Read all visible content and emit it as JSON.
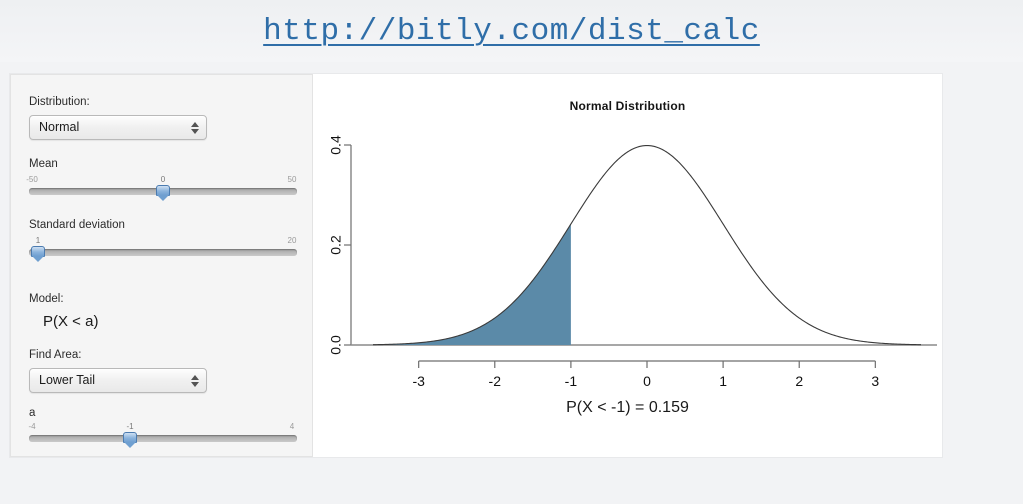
{
  "header": {
    "url": "http://bitly.com/dist_calc",
    "link_color": "#2f6ea8"
  },
  "sidebar": {
    "distribution_label": "Distribution:",
    "distribution_value": "Normal",
    "mean_label": "Mean",
    "mean_slider": {
      "min_label": "-50",
      "value_label": "0",
      "max_label": "50",
      "min": -50,
      "max": 50,
      "value": 0
    },
    "sd_label": "Standard deviation",
    "sd_slider": {
      "min_label": "1",
      "value_label": "1",
      "max_label": "20",
      "min": 1,
      "max": 20,
      "value": 1
    },
    "model_label": "Model:",
    "model_expression": "P(X < a)",
    "find_area_label": "Find Area:",
    "find_area_value": "Lower Tail",
    "a_label": "a",
    "a_slider": {
      "min_label": "-4",
      "value_label": "-1",
      "max_label": "4",
      "min": -4,
      "max": 4,
      "value": -1
    }
  },
  "plot": {
    "result_text": "P(X < -1) = 0.159",
    "fill_color": "#5b8aa8",
    "curve_color": "#3a3a3a"
  },
  "chart_data": {
    "type": "line",
    "title": "Normal Distribution",
    "xlabel": "",
    "ylabel": "",
    "xlim": [
      -3.6,
      3.6
    ],
    "ylim": [
      0.0,
      0.42
    ],
    "xticks": [
      -3,
      -2,
      -1,
      0,
      1,
      2,
      3
    ],
    "xtick_labels": [
      "-3",
      "-2",
      "-1",
      "0",
      "1",
      "2",
      "3"
    ],
    "yticks": [
      0.0,
      0.2,
      0.4
    ],
    "ytick_labels": [
      "0.0",
      "0.2",
      "0.4"
    ],
    "grid": false,
    "legend": false,
    "distribution": "normal",
    "mean": 0,
    "sd": 1,
    "shaded_region": {
      "type": "lower-tail",
      "from": -3.6,
      "to": -1,
      "area": 0.159,
      "label": "P(X < -1) = 0.159"
    },
    "x": [
      -3.6,
      -3.2,
      -2.8,
      -2.4,
      -2.0,
      -1.6,
      -1.2,
      -1.0,
      -0.8,
      -0.4,
      0.0,
      0.4,
      0.8,
      1.0,
      1.2,
      1.6,
      2.0,
      2.4,
      2.8,
      3.2,
      3.6
    ],
    "y": [
      0.0006,
      0.0024,
      0.0079,
      0.0224,
      0.054,
      0.1109,
      0.1942,
      0.242,
      0.2897,
      0.3683,
      0.3989,
      0.3683,
      0.2897,
      0.242,
      0.1942,
      0.1109,
      0.054,
      0.0224,
      0.0079,
      0.0024,
      0.0006
    ]
  }
}
